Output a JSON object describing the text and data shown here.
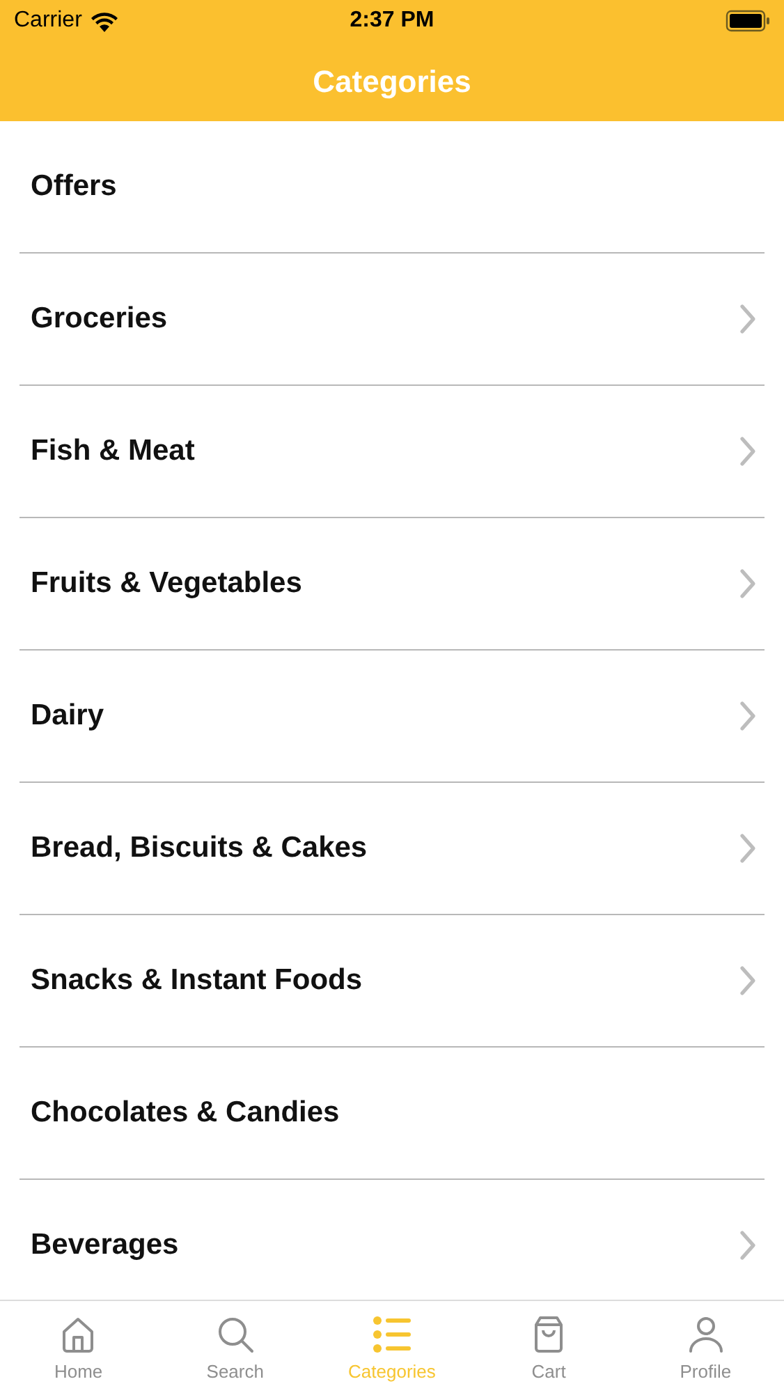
{
  "status_bar": {
    "carrier": "Carrier",
    "time": "2:37 PM"
  },
  "nav_bar": {
    "title": "Categories"
  },
  "categories": [
    {
      "label": "Offers",
      "disclosure": false
    },
    {
      "label": "Groceries",
      "disclosure": true
    },
    {
      "label": "Fish & Meat",
      "disclosure": true
    },
    {
      "label": "Fruits & Vegetables",
      "disclosure": true
    },
    {
      "label": "Dairy",
      "disclosure": true
    },
    {
      "label": "Bread, Biscuits & Cakes",
      "disclosure": true
    },
    {
      "label": "Snacks & Instant Foods",
      "disclosure": true
    },
    {
      "label": "Chocolates & Candies",
      "disclosure": false
    },
    {
      "label": "Beverages",
      "disclosure": true
    }
  ],
  "tab_bar": [
    {
      "kind": "home",
      "label": "Home",
      "selected": false
    },
    {
      "kind": "search",
      "label": "Search",
      "selected": false
    },
    {
      "kind": "list",
      "label": "Categories",
      "selected": true
    },
    {
      "kind": "bag",
      "label": "Cart",
      "selected": false
    },
    {
      "kind": "person",
      "label": "Profile",
      "selected": false
    }
  ]
}
